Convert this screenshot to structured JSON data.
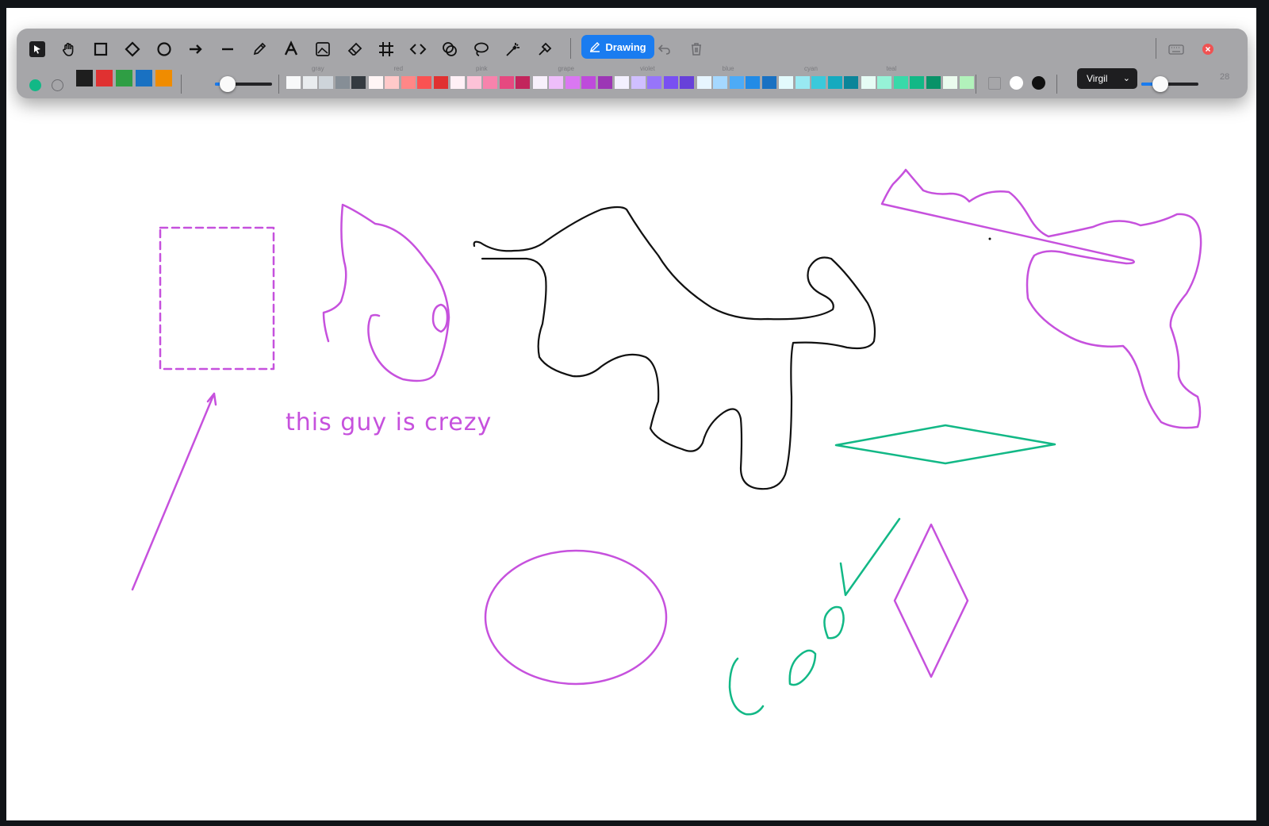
{
  "toolbar": {
    "tools": [
      {
        "name": "select-tool",
        "icon": "cursor-icon"
      },
      {
        "name": "hand-tool",
        "icon": "hand-icon"
      },
      {
        "name": "rectangle-tool",
        "icon": "square-icon"
      },
      {
        "name": "diamond-tool",
        "icon": "diamond-icon"
      },
      {
        "name": "ellipse-tool",
        "icon": "circle-icon"
      },
      {
        "name": "arrow-tool",
        "icon": "arrow-icon"
      },
      {
        "name": "line-tool",
        "icon": "line-icon"
      },
      {
        "name": "pencil-tool",
        "icon": "pencil-icon"
      },
      {
        "name": "text-tool",
        "icon": "text-icon"
      },
      {
        "name": "image-tool",
        "icon": "image-icon"
      },
      {
        "name": "eraser-tool",
        "icon": "eraser-icon"
      },
      {
        "name": "frame-tool",
        "icon": "frame-icon"
      },
      {
        "name": "embed-tool",
        "icon": "embed-icon"
      },
      {
        "name": "shapes-tool",
        "icon": "shapes-icon"
      },
      {
        "name": "lasso-tool",
        "icon": "lasso-icon"
      },
      {
        "name": "magic-tool",
        "icon": "magic-wand-icon"
      },
      {
        "name": "laser-tool",
        "icon": "laser-icon"
      }
    ],
    "mode_label": "Drawing",
    "font_family": "Virgil",
    "stroke_width_value": "28",
    "primary_colors": [
      "#1e1e1e",
      "#e03131",
      "#2f9e44",
      "#1971c2",
      "#f08c00"
    ],
    "stroke_color_active": "#12b886",
    "palette_groups": [
      {
        "label": "gray",
        "colors": [
          "#f8f9fa",
          "#e9ecef",
          "#ced4da",
          "#868e96",
          "#343a40"
        ]
      },
      {
        "label": "red",
        "colors": [
          "#fff5f5",
          "#ffc9c9",
          "#ff8787",
          "#fa5252",
          "#e03131"
        ]
      },
      {
        "label": "pink",
        "colors": [
          "#fff0f6",
          "#fcc2d7",
          "#f783ac",
          "#e64980",
          "#c2255c"
        ]
      },
      {
        "label": "grape",
        "colors": [
          "#f8f0fc",
          "#eebefa",
          "#da77f2",
          "#be4bdb",
          "#9c36b5"
        ]
      },
      {
        "label": "violet",
        "colors": [
          "#f3f0ff",
          "#d0bfff",
          "#9775fa",
          "#7950f2",
          "#6741d9"
        ]
      },
      {
        "label": "blue",
        "colors": [
          "#e7f5ff",
          "#a5d8ff",
          "#4dabf7",
          "#228be6",
          "#1971c2"
        ]
      },
      {
        "label": "cyan",
        "colors": [
          "#e3fafc",
          "#99e9f2",
          "#3bc9db",
          "#15aabf",
          "#0c8599"
        ]
      },
      {
        "label": "teal",
        "colors": [
          "#e6fcf5",
          "#96f2d7",
          "#38d9a9",
          "#12b886",
          "#099268"
        ]
      },
      {
        "label": "",
        "colors": [
          "#ebfbee",
          "#b2f2bb"
        ]
      }
    ],
    "accent": "#1a7cf0"
  },
  "canvas": {
    "annotation_text": "this guy is crezy",
    "stroke_colors": {
      "purple": "#c651dd",
      "green": "#12b886",
      "black": "#111111"
    }
  }
}
